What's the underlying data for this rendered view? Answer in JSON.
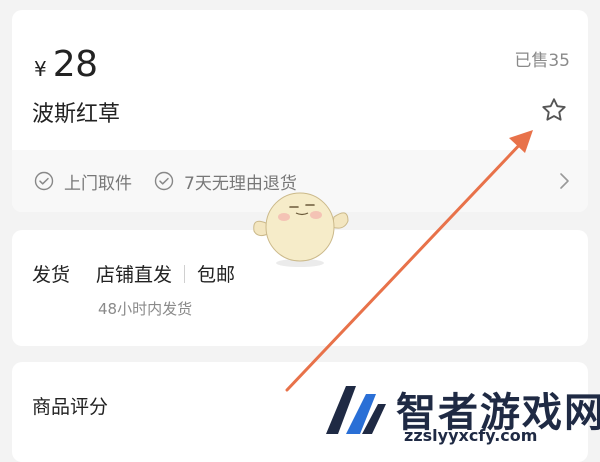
{
  "product": {
    "currency": "¥",
    "price": "28",
    "sold": "已售35",
    "title": "波斯红草",
    "promises": [
      "上门取件",
      "7天无理由退货"
    ]
  },
  "shipping": {
    "label": "发货",
    "method": "店铺直发",
    "fee": "包邮",
    "note": "48小时内发货"
  },
  "review": {
    "title": "商品评分"
  },
  "watermark": {
    "name": "智者游戏网",
    "url": "zzslyyxcfy.com"
  },
  "colors": {
    "arrow": "#e8724a",
    "text": "#222222",
    "muted": "#8a8a8a",
    "background": "#f3f3f3"
  },
  "icons": {
    "favorite": "star-outline-icon",
    "promise": "check-circle-icon",
    "more": "chevron-right-icon"
  }
}
